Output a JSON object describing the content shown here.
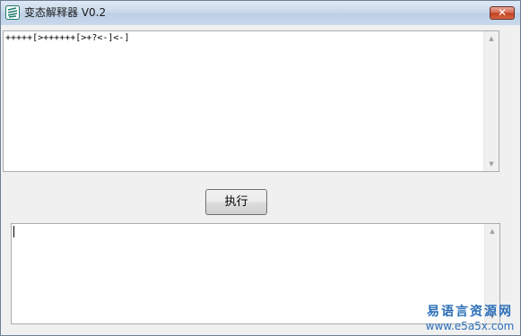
{
  "window": {
    "title": "变态解释器 V0.2",
    "close_glyph": "✕",
    "icon": "app-icon"
  },
  "editor": {
    "code": "+++++[>++++++[>+?<-]<-]",
    "scroll_up_glyph": "▲",
    "scroll_down_glyph": "▼"
  },
  "toolbar": {
    "run_label": "执行"
  },
  "output": {
    "value": "",
    "scroll_up_glyph": "▲",
    "scroll_down_glyph": "▼"
  },
  "watermark": {
    "brand": "易语言资源网",
    "url": "www.e5a5x.com"
  },
  "colors": {
    "titlebar": "#c8d8ea",
    "close_button": "#c2411f",
    "watermark": "#2c6fb8"
  }
}
